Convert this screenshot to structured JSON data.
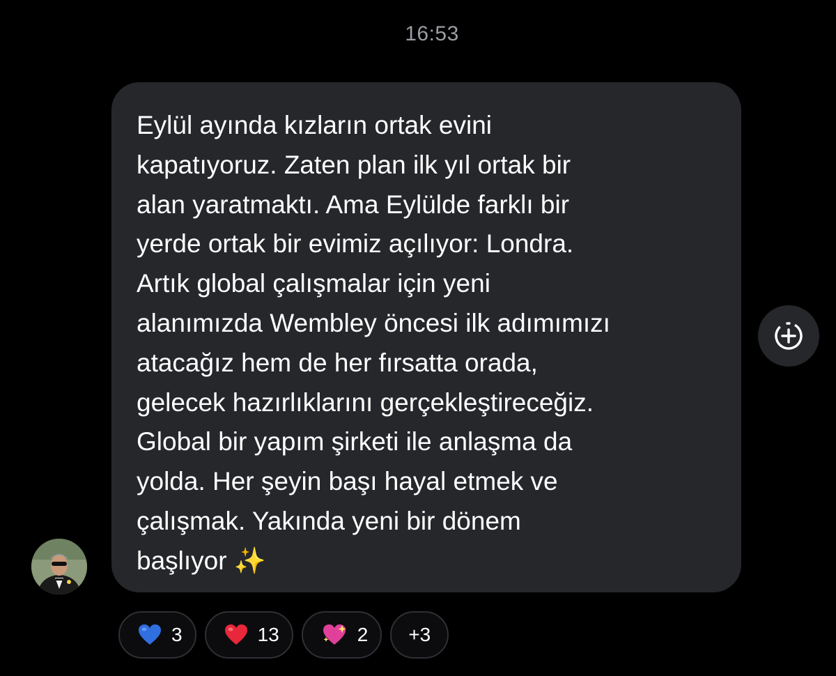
{
  "chat": {
    "timestamp": "16:53",
    "message": {
      "text": "Eylül ayında kızların ortak evini\nkapatıyoruz. Zaten plan ilk yıl ortak bir\nalan yaratmaktı. Ama Eylülde farklı bir\nyerde ortak bir evimiz açılıyor: Londra.\nArtık global çalışmalar için yeni\nalanımızda Wembley öncesi ilk adımımızı\natacağız hem de her fırsatta orada,\ngelecek hazırlıklarını gerçekleştireceğiz.\nGlobal bir yapım şirketi ile anlaşma da\nyolda. Her şeyin başı hayal etmek ve\nçalışmak. Yakında yeni bir dönem\nbaşlıyor ",
      "trailing_emoji": "✨"
    },
    "add_reaction_icon": "add-reaction-icon",
    "sender_avatar_icon": "avatar",
    "reactions": [
      {
        "emoji": "blue-heart",
        "count": "3",
        "color": "#2f6fe0"
      },
      {
        "emoji": "red-heart",
        "count": "13",
        "color": "#e8283a"
      },
      {
        "emoji": "sparkling-heart",
        "count": "2",
        "color": "#e0409a"
      }
    ],
    "more_reactions": "+3"
  }
}
